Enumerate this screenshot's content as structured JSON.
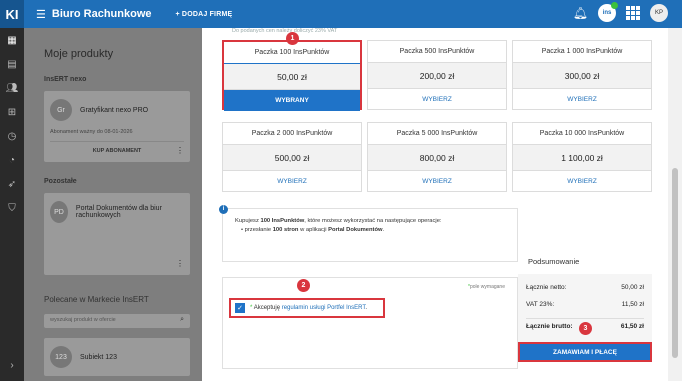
{
  "topbar": {
    "logo": "KI",
    "app_title": "Biuro Rachunkowe",
    "add_company": "+ DODAJ FIRMĘ",
    "ins_badge": "ins",
    "avatar": "KP"
  },
  "left": {
    "title": "Moje produkty",
    "section1": "InsERT nexo",
    "product1": {
      "avatar": "Gr",
      "name": "Gratyfikant nexo PRO",
      "sub": "Abonament ważny do 08-01-2026",
      "action": "KUP ABONAMENT"
    },
    "section2": "Pozostałe",
    "product2": {
      "avatar": "PD",
      "name": "Portal Dokumentów dla biur rachunkowych"
    },
    "section3": "Polecane w Markecie InsERT",
    "search_placeholder": "wyszukaj produkt w ofercie",
    "product3": {
      "avatar": "123",
      "name": "Subiekt 123"
    }
  },
  "dialog": {
    "vat_note": "Do podanych cen należy doliczyć 23% VAT",
    "packages": [
      {
        "title": "Paczka 100 InsPunktów",
        "price": "50,00 zł",
        "button": "WYBRANY",
        "selected": true
      },
      {
        "title": "Paczka 500 InsPunktów",
        "price": "200,00 zł",
        "button": "WYBIERZ",
        "selected": false
      },
      {
        "title": "Paczka 1 000 InsPunktów",
        "price": "300,00 zł",
        "button": "WYBIERZ",
        "selected": false
      },
      {
        "title": "Paczka 2 000 InsPunktów",
        "price": "500,00 zł",
        "button": "WYBIERZ",
        "selected": false
      },
      {
        "title": "Paczka 5 000 InsPunktów",
        "price": "800,00 zł",
        "button": "WYBIERZ",
        "selected": false
      },
      {
        "title": "Paczka 10 000 InsPunktów",
        "price": "1 100,00 zł",
        "button": "WYBIERZ",
        "selected": false
      }
    ],
    "info_line1_pre": "Kupujesz ",
    "info_line1_bold": "100 InsPunktów",
    "info_line1_post": ", które możesz wykorzystać na następujące operacje:",
    "info_bullet_pre": "przesłanie ",
    "info_bullet_bold1": "100 stron",
    "info_bullet_mid": " w aplikacji ",
    "info_bullet_bold2": "Portal Dokumentów",
    "info_bullet_post": ".",
    "required_note": "pole wymagane",
    "consent_pre": "Akceptuję ",
    "consent_link": "regulamin usługi Portfel InsERT",
    "consent_post": ".",
    "summary_title": "Podsumowanie",
    "net_label": "Łącznie netto:",
    "net_value": "50,00 zł",
    "vat_label": "VAT 23%:",
    "vat_value": "11,50 zł",
    "gross_label": "Łącznie brutto:",
    "gross_value": "61,50 zł",
    "order_button": "ZAMAWIAM I PŁACĘ",
    "callouts": [
      "1",
      "2",
      "3"
    ]
  }
}
